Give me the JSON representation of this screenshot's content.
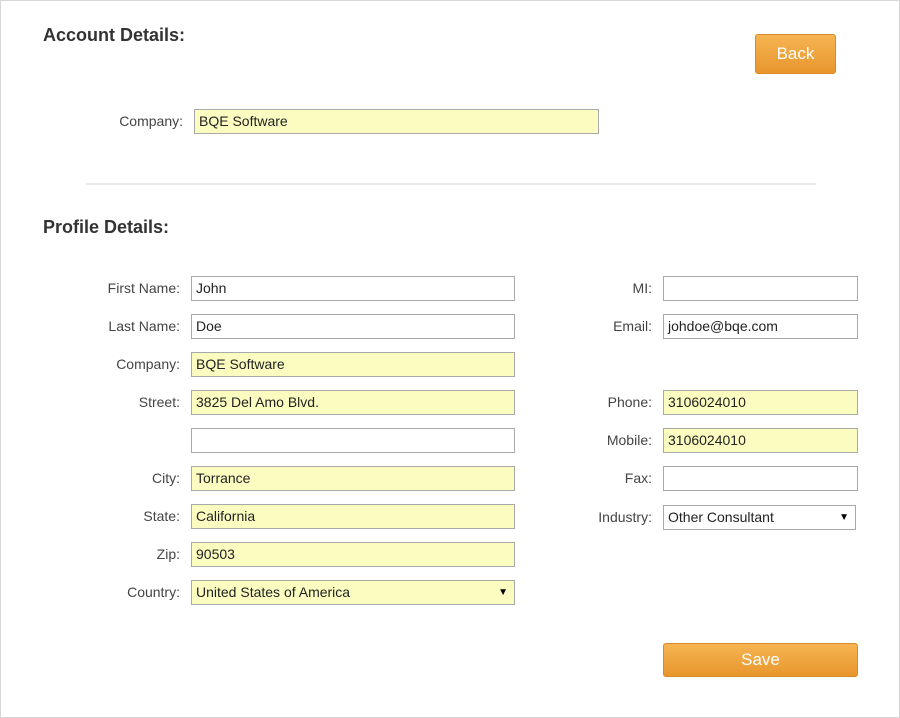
{
  "account": {
    "title": "Account Details:",
    "back_label": "Back",
    "company_label": "Company:",
    "company_value": "BQE Software"
  },
  "profile": {
    "title": "Profile Details:",
    "labels": {
      "first_name": "First Name:",
      "last_name": "Last Name:",
      "company": "Company:",
      "street": "Street:",
      "city": "City:",
      "state": "State:",
      "zip": "Zip:",
      "country": "Country:",
      "mi": "MI:",
      "email": "Email:",
      "phone": "Phone:",
      "mobile": "Mobile:",
      "fax": "Fax:",
      "industry": "Industry:"
    },
    "values": {
      "first_name": "John",
      "last_name": "Doe",
      "company": "BQE Software",
      "street": "3825 Del Amo Blvd.",
      "street2": "",
      "city": "Torrance",
      "state": "California",
      "zip": "90503",
      "country": "United States of America",
      "mi": "",
      "email": "johdoe@bqe.com",
      "phone": "3106024010",
      "mobile": "3106024010",
      "fax": "",
      "industry": "Other Consultant"
    },
    "save_label": "Save"
  },
  "colors": {
    "required_field_bg": "#fbfdc0",
    "button_bg": "#f0a540",
    "border": "#a9a9a9"
  },
  "icons": {
    "dropdown": "chevron-down-icon"
  }
}
